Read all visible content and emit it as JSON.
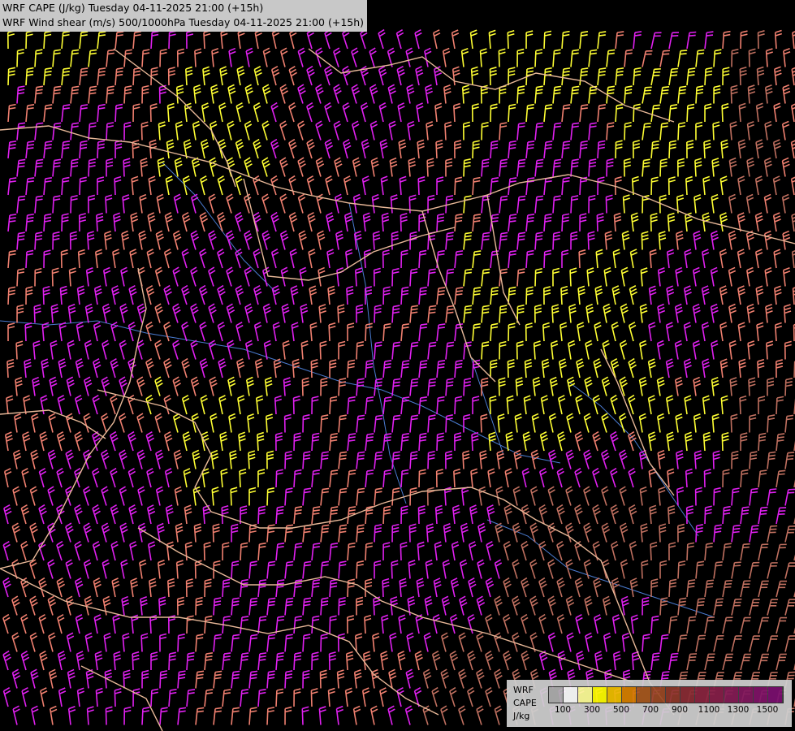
{
  "titles": {
    "line1": "WRF CAPE (J/kg) Tuesday 04-11-2025 21:00 (+15h)",
    "line2": "WRF Wind shear (m/s) 500/1000hPa Tuesday 04-11-2025 21:00 (+15h)"
  },
  "legend": {
    "model": "WRF",
    "field": "CAPE",
    "unit": "J/kg",
    "colors": [
      "#b0b0b0",
      "#ffffff",
      "#ffff99",
      "#ffff00",
      "#f0c000",
      "#d88000",
      "#a85a20",
      "#9a4a25",
      "#8f3a2a",
      "#8a2d35",
      "#8a2540",
      "#87204a",
      "#851c55",
      "#82185e",
      "#801468",
      "#7c1070"
    ],
    "tick_labels": [
      "100",
      "300",
      "500",
      "700",
      "900",
      "1100",
      "1300",
      "1500"
    ]
  },
  "barb_colors": {
    "yellow": "#ffff33",
    "magenta": "#e020f0",
    "salmon": "#f08070",
    "brown": "#c07060",
    "border": "#e8b898",
    "river": "#4a7bd0"
  }
}
